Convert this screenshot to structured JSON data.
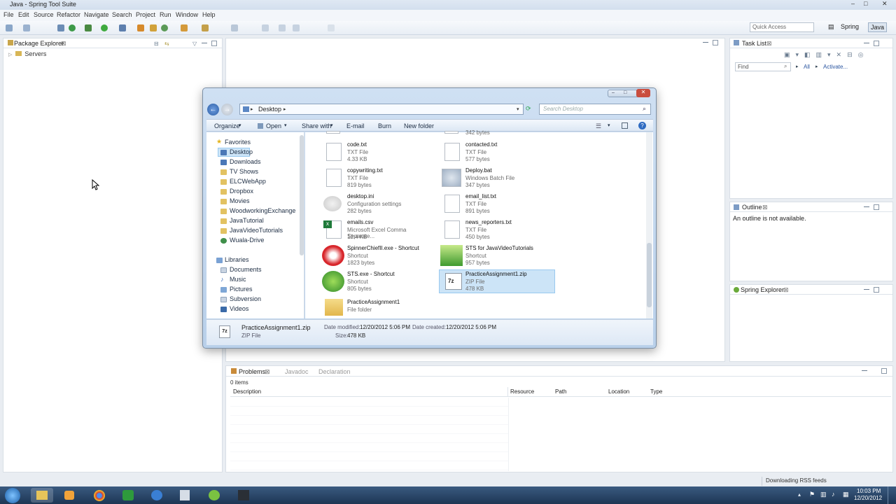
{
  "window": {
    "title": "Java - Spring Tool Suite",
    "controls": [
      "–",
      "□",
      "✕"
    ]
  },
  "menu": [
    "File",
    "Edit",
    "Source",
    "Refactor",
    "Navigate",
    "Search",
    "Project",
    "Run",
    "Window",
    "Help"
  ],
  "quick_access": {
    "placeholder": "Quick Access"
  },
  "perspectives": {
    "spring": "Spring",
    "java": "Java"
  },
  "package_explorer": {
    "title": "Package Explorer",
    "items": [
      {
        "label": "Servers"
      }
    ]
  },
  "task_list": {
    "title": "Task List",
    "find_placeholder": "Find",
    "all_label": "All",
    "activate_label": "Activate..."
  },
  "outline": {
    "title": "Outline",
    "message": "An outline is not available."
  },
  "spring_explorer": {
    "title": "Spring Explorer"
  },
  "explorer": {
    "address": "Desktop",
    "search_placeholder": "Search Desktop",
    "commands": {
      "organize": "Organize",
      "open": "Open",
      "share_with": "Share with",
      "email": "E-mail",
      "burn": "Burn",
      "new_folder": "New folder"
    },
    "nav": {
      "favorites_label": "Favorites",
      "favorites": [
        "Desktop",
        "Downloads",
        "TV Shows",
        "ELCWebApp",
        "Dropbox",
        "Movies",
        "WoodworkingExchange",
        "JavaTutorial",
        "JavaVideoTutorials",
        "Wuala-Drive"
      ],
      "libraries_label": "Libraries",
      "libraries": [
        "Documents",
        "Music",
        "Pictures",
        "Subversion",
        "Videos"
      ]
    },
    "files": {
      "truncated_top": "342 bytes",
      "left": [
        {
          "name": "code.txt",
          "type": "TXT File",
          "size": "4.33 KB"
        },
        {
          "name": "copywriting.txt",
          "type": "TXT File",
          "size": "819 bytes"
        },
        {
          "name": "desktop.ini",
          "type": "Configuration settings",
          "size": "282 bytes"
        },
        {
          "name": "emails.csv",
          "type": "Microsoft Excel Comma Separate...",
          "size": "12.4 KB"
        },
        {
          "name": "SpinnerChiefII.exe - Shortcut",
          "type": "Shortcut",
          "size": "1823 bytes"
        },
        {
          "name": "STS.exe - Shortcut",
          "type": "Shortcut",
          "size": "805 bytes"
        },
        {
          "name": "PracticeAssignment1",
          "type": "File folder",
          "size": ""
        }
      ],
      "right": [
        {
          "name": "contacted.txt",
          "type": "TXT File",
          "size": "577 bytes"
        },
        {
          "name": "Deploy.bat",
          "type": "Windows Batch File",
          "size": "347 bytes"
        },
        {
          "name": "email_list.txt",
          "type": "TXT File",
          "size": "891 bytes"
        },
        {
          "name": "news_reporters.txt",
          "type": "TXT File",
          "size": "450 bytes"
        },
        {
          "name": "STS for JavaVideoTutorials",
          "type": "Shortcut",
          "size": "957 bytes"
        },
        {
          "name": "PracticeAssignment1.zip",
          "type": "ZIP File",
          "size": "478 KB"
        }
      ]
    },
    "details": {
      "name": "PracticeAssignment1.zip",
      "type": "ZIP File",
      "modified_label": "Date modified:",
      "modified": "12/20/2012 5:06 PM",
      "size_label": "Size:",
      "size": "478 KB",
      "created_label": "Date created:",
      "created": "12/20/2012 5:06 PM"
    }
  },
  "problems": {
    "tabs": [
      "Problems",
      "Javadoc",
      "Declaration"
    ],
    "count": "0 items",
    "columns": [
      "Description",
      "Resource",
      "Path",
      "Location",
      "Type"
    ]
  },
  "status_bar": {
    "message": "Downloading RSS feeds"
  },
  "taskbar": {
    "time": "10:03 PM",
    "date": "12/20/2012"
  },
  "colors": {
    "selection": "#cce4f7",
    "accent": "#3399ff",
    "taskbar": "#1d3654"
  }
}
